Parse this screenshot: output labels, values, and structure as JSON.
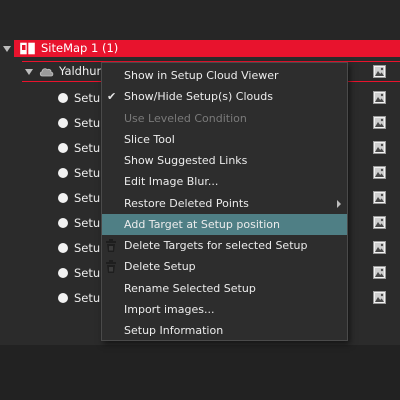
{
  "tree": {
    "sitemap_label": "SiteMap 1 (1)",
    "cloud_label": "Yaldhur",
    "setup_items": [
      {
        "label": "Setup"
      },
      {
        "label": "Setup"
      },
      {
        "label": "Setup"
      },
      {
        "label": "Setup"
      },
      {
        "label": "Setup"
      },
      {
        "label": "Setup"
      },
      {
        "label": "Setup"
      },
      {
        "label": "Setup"
      },
      {
        "label": "Setup"
      }
    ]
  },
  "context_menu": {
    "items": [
      {
        "label": "Show in Setup Cloud Viewer",
        "checked": false,
        "disabled": false,
        "highlighted": false,
        "submenu": false,
        "icon": null
      },
      {
        "label": "Show/Hide Setup(s) Clouds",
        "checked": true,
        "disabled": false,
        "highlighted": false,
        "submenu": false,
        "icon": null
      },
      {
        "label": "Use Leveled Condition",
        "checked": false,
        "disabled": true,
        "highlighted": false,
        "submenu": false,
        "icon": null
      },
      {
        "label": "Slice Tool",
        "checked": false,
        "disabled": false,
        "highlighted": false,
        "submenu": false,
        "icon": null
      },
      {
        "label": "Show Suggested Links",
        "checked": false,
        "disabled": false,
        "highlighted": false,
        "submenu": false,
        "icon": null
      },
      {
        "label": "Edit Image Blur...",
        "checked": false,
        "disabled": false,
        "highlighted": false,
        "submenu": false,
        "icon": null
      },
      {
        "label": "Restore Deleted Points",
        "checked": false,
        "disabled": false,
        "highlighted": false,
        "submenu": true,
        "icon": null
      },
      {
        "label": "Add Target at Setup position",
        "checked": false,
        "disabled": false,
        "highlighted": true,
        "submenu": false,
        "icon": null
      },
      {
        "label": "Delete Targets for selected Setup",
        "checked": false,
        "disabled": false,
        "highlighted": false,
        "submenu": false,
        "icon": "trash-icon"
      },
      {
        "label": "Delete Setup",
        "checked": false,
        "disabled": false,
        "highlighted": false,
        "submenu": false,
        "icon": "trash-icon"
      },
      {
        "label": "Rename Selected Setup",
        "checked": false,
        "disabled": false,
        "highlighted": false,
        "submenu": false,
        "icon": null
      },
      {
        "label": "Import images...",
        "checked": false,
        "disabled": false,
        "highlighted": false,
        "submenu": false,
        "icon": null
      },
      {
        "label": "Setup Information",
        "checked": false,
        "disabled": false,
        "highlighted": false,
        "submenu": false,
        "icon": null
      }
    ]
  },
  "colors": {
    "sitemap_bar": "#e8132d",
    "menu_highlight": "#4f7f85",
    "tree_background": "#2b2b2b"
  }
}
